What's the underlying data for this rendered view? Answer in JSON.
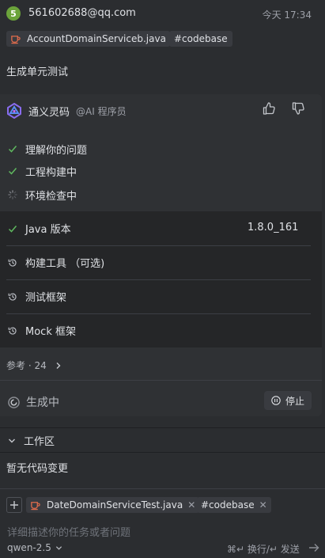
{
  "user": {
    "avatar_letter": "5",
    "email": "561602688@qq.com",
    "time": "今天 17:34",
    "file_tag": "AccountDomainServiceb.java",
    "code_tag": "#codebase",
    "prompt": "生成单元测试"
  },
  "assistant": {
    "name": "通义灵码",
    "role": "@AI 程序员",
    "steps": [
      {
        "label": "理解你的问题",
        "status": "done"
      },
      {
        "label": "工程构建中",
        "status": "done"
      },
      {
        "label": "环境检查中",
        "status": "loading"
      }
    ],
    "env": [
      {
        "label": "Java 版本",
        "value": "1.8.0_161",
        "status": "done"
      },
      {
        "label": "构建工具 （可选)",
        "value": "",
        "status": "pending"
      },
      {
        "label": "测试框架",
        "value": "",
        "status": "pending"
      },
      {
        "label": "Mock 框架",
        "value": "",
        "status": "pending"
      }
    ],
    "refs": "参考 · 24",
    "generating": "生成中",
    "stop": "停止"
  },
  "workspace": {
    "title": "工作区",
    "empty": "暂无代码变更"
  },
  "input": {
    "ctx_file": "DateDomainServiceTest.java",
    "ctx_code": "#codebase",
    "placeholder": "详细描述你的任务或者问题",
    "model": "qwen-2.5",
    "hint": "⌘↵ 换行/↵ 发送"
  },
  "colors": {
    "accent_green": "#5fb85f",
    "java_icon": "#e06c4c",
    "avatar": "#6ba33b"
  }
}
